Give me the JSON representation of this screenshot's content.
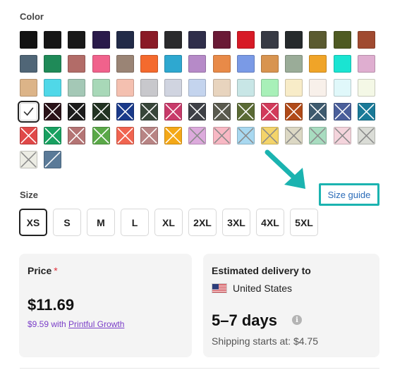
{
  "color_section": {
    "label": "Color",
    "rows": [
      [
        {
          "c": "#121212",
          "x": false
        },
        {
          "c": "#161616",
          "x": false
        },
        {
          "c": "#191919",
          "x": false
        },
        {
          "c": "#2a1a4a",
          "x": false
        },
        {
          "c": "#222b48",
          "x": false
        },
        {
          "c": "#8a1a26",
          "x": false
        },
        {
          "c": "#2a2a2c",
          "x": false
        },
        {
          "c": "#2f2e4a",
          "x": false
        },
        {
          "c": "#6a1a36",
          "x": false
        },
        {
          "c": "#d71a26",
          "x": false
        },
        {
          "c": "#373a44",
          "x": false
        },
        {
          "c": "#262a2c",
          "x": false
        },
        {
          "c": "#5a5a30",
          "x": false
        },
        {
          "c": "#4e5a22",
          "x": false
        },
        {
          "c": "#a04a30",
          "x": false
        }
      ],
      [
        {
          "c": "#506677",
          "x": false
        },
        {
          "c": "#1f8a58",
          "x": false
        },
        {
          "c": "#b26c68",
          "x": false
        },
        {
          "c": "#f0628c",
          "x": false
        },
        {
          "c": "#9a8475",
          "x": false
        },
        {
          "c": "#f46a2e",
          "x": false
        },
        {
          "c": "#2ea8d0",
          "x": false
        },
        {
          "c": "#b68ac8",
          "x": false
        },
        {
          "c": "#e88a48",
          "x": false
        },
        {
          "c": "#7a9ae6",
          "x": false
        },
        {
          "c": "#d89450",
          "x": false
        },
        {
          "c": "#9aac98",
          "x": false
        },
        {
          "c": "#f0a428",
          "x": false
        },
        {
          "c": "#1ae4d2",
          "x": false
        },
        {
          "c": "#dfaed0",
          "x": false
        }
      ],
      [
        {
          "c": "#dcb488",
          "x": false
        },
        {
          "c": "#50d8e8",
          "x": false
        },
        {
          "c": "#a4c8b6",
          "x": false
        },
        {
          "c": "#a8d8b8",
          "x": false
        },
        {
          "c": "#f4c0b0",
          "x": false
        },
        {
          "c": "#c8c8cc",
          "x": false
        },
        {
          "c": "#d0d4e0",
          "x": false
        },
        {
          "c": "#c4d4ee",
          "x": false
        },
        {
          "c": "#e8d4be",
          "x": false
        },
        {
          "c": "#c8e6e6",
          "x": false
        },
        {
          "c": "#a8f0b8",
          "x": false
        },
        {
          "c": "#f8ecc8",
          "x": false
        },
        {
          "c": "#f8f0ea",
          "x": false
        },
        {
          "c": "#e0f8fa",
          "x": false
        },
        {
          "c": "#f4f8e6",
          "x": false
        }
      ],
      [
        {
          "c": "#ffffff",
          "x": false,
          "check": true
        },
        {
          "c": "#2a1218",
          "x": true
        },
        {
          "c": "#1c1c1c",
          "x": true
        },
        {
          "c": "#223322",
          "x": true
        },
        {
          "c": "#1a3a8a",
          "x": true
        },
        {
          "c": "#38463a",
          "x": true
        },
        {
          "c": "#c83a6a",
          "x": true
        },
        {
          "c": "#3e4046",
          "x": true
        },
        {
          "c": "#5a5a4e",
          "x": true
        },
        {
          "c": "#5a6a34",
          "x": true
        },
        {
          "c": "#d23a5a",
          "x": true
        },
        {
          "c": "#b04a18",
          "x": true
        },
        {
          "c": "#3e5a6e",
          "x": true
        },
        {
          "c": "#4a5e9a",
          "x": true
        },
        {
          "c": "#1a7a98",
          "x": true
        }
      ],
      [
        {
          "c": "#e04848",
          "x": true
        },
        {
          "c": "#18a060",
          "x": true
        },
        {
          "c": "#b47474",
          "x": true
        },
        {
          "c": "#5aa848",
          "x": true
        },
        {
          "c": "#f06450",
          "x": true
        },
        {
          "c": "#b88484",
          "x": true
        },
        {
          "c": "#f4a818",
          "x": true
        },
        {
          "c": "#dcaadc",
          "x": true
        },
        {
          "c": "#f8b8c4",
          "x": true
        },
        {
          "c": "#a8d8f0",
          "x": true
        },
        {
          "c": "#f4d46a",
          "x": true
        },
        {
          "c": "#dcd8c4",
          "x": true
        },
        {
          "c": "#a8dcc0",
          "x": true
        },
        {
          "c": "#f4d4dc",
          "x": true
        },
        {
          "c": "#dadcd6",
          "x": true
        }
      ],
      [
        {
          "c": "#ecece4",
          "x": true
        },
        {
          "c": "#5a7a98",
          "slash": true
        }
      ]
    ]
  },
  "size_section": {
    "label": "Size",
    "sizes": [
      "XS",
      "S",
      "M",
      "L",
      "XL",
      "2XL",
      "3XL",
      "4XL",
      "5XL"
    ],
    "selected": "XS",
    "guide_link": "Size guide"
  },
  "price_card": {
    "title": "Price",
    "required_mark": "*",
    "price": "$11.69",
    "growth_prefix": "$9.59 with ",
    "growth_link": "Printful Growth"
  },
  "delivery_card": {
    "title": "Estimated delivery to",
    "country": "United States",
    "days": "5–7 days",
    "info_icon": "i",
    "shipping": "Shipping starts at: $4.75"
  },
  "colors": {
    "accent_teal": "#1bb3b0",
    "link_blue": "#2a6bb8",
    "growth_purple": "#7a3ec8",
    "required_red": "#e0303c"
  },
  "icons": {
    "flag": "us-flag-icon",
    "info": "info-icon",
    "check": "check-icon",
    "arrow": "teal-arrow-icon"
  }
}
